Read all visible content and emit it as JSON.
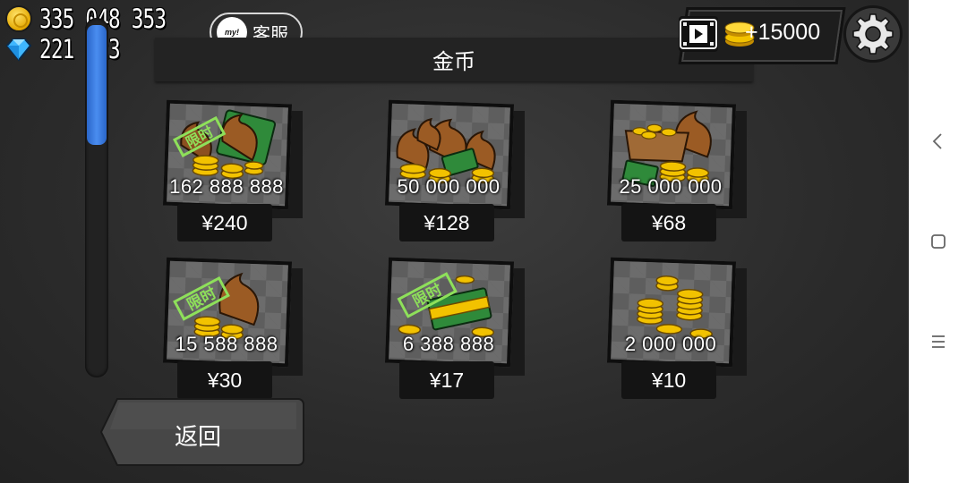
{
  "hud": {
    "coins": "335 048 353",
    "gems": "221 023",
    "coin_icon": "gold-coin-icon",
    "gem_icon": "blue-diamond-icon"
  },
  "header": {
    "support_label": "客服",
    "support_badge": "my!",
    "title": "金币",
    "video_reward_amount": "+15000"
  },
  "shop": {
    "items": [
      {
        "amount": "162 888 888",
        "price": "¥240",
        "limited": true,
        "image": "money-bags-cash-coins"
      },
      {
        "amount": "50 000 000",
        "price": "¥128",
        "limited": false,
        "image": "many-money-bags"
      },
      {
        "amount": "25 000 000",
        "price": "¥68",
        "limited": false,
        "image": "open-bag-coins"
      },
      {
        "amount": "15 588 888",
        "price": "¥30",
        "limited": true,
        "image": "single-bag-coins"
      },
      {
        "amount": "6 388 888",
        "price": "¥17",
        "limited": true,
        "image": "cash-stack-coins"
      },
      {
        "amount": "2 000 000",
        "price": "¥10",
        "limited": false,
        "image": "coin-piles"
      }
    ]
  },
  "footer": {
    "back_label": "返回"
  },
  "colors": {
    "background": "#2e2e2e",
    "scroll_thumb": "#3a7be0",
    "gold": "#f2c200",
    "cash_green": "#2f8a3a"
  },
  "navbar": {
    "icons": [
      "back-icon",
      "home-icon",
      "recents-icon"
    ]
  }
}
